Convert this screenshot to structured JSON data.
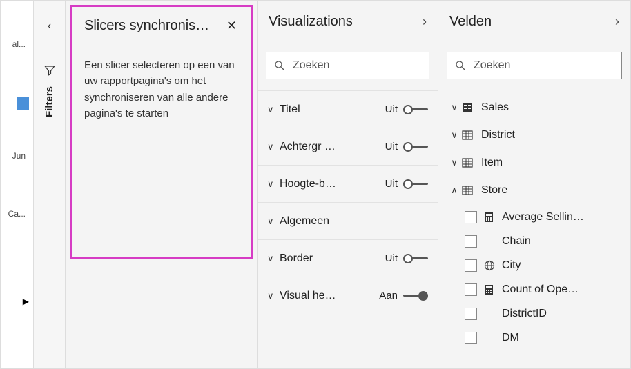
{
  "left_strip": {
    "item_top": "al...",
    "item_mid": "Jun",
    "item_bot": "Ca..."
  },
  "filters_tab": {
    "label": "Filters"
  },
  "sync_pane": {
    "title": "Slicers synchronis…",
    "description": "Een slicer selecteren op een van uw rapportpagina's om het synchroniseren van alle andere pagina's te starten"
  },
  "viz_pane": {
    "title": "Visualizations",
    "search_placeholder": "Zoeken",
    "props": [
      {
        "name": "Titel",
        "state": "Uit",
        "on": false
      },
      {
        "name": "Achtergr …",
        "state": "Uit",
        "on": false
      },
      {
        "name": "Hoogte-b…",
        "state": "Uit",
        "on": false
      },
      {
        "name": "Algemeen",
        "state": "",
        "on": null
      },
      {
        "name": "Border",
        "state": "Uit",
        "on": false
      },
      {
        "name": "Visual he…",
        "state": "Aan",
        "on": true
      }
    ]
  },
  "fields_pane": {
    "title": "Velden",
    "search_placeholder": "Zoeken",
    "tables": [
      {
        "name": "Sales",
        "icon": "calc-table",
        "expanded": false
      },
      {
        "name": "District",
        "icon": "table",
        "expanded": false
      },
      {
        "name": "Item",
        "icon": "table",
        "expanded": false
      },
      {
        "name": "Store",
        "icon": "table",
        "expanded": true,
        "children": [
          {
            "name": "Average Sellin…",
            "icon": "calc"
          },
          {
            "name": "Chain",
            "icon": ""
          },
          {
            "name": "City",
            "icon": "globe"
          },
          {
            "name": "Count of Ope…",
            "icon": "calc"
          },
          {
            "name": "DistrictID",
            "icon": ""
          },
          {
            "name": "DM",
            "icon": ""
          }
        ]
      }
    ]
  }
}
